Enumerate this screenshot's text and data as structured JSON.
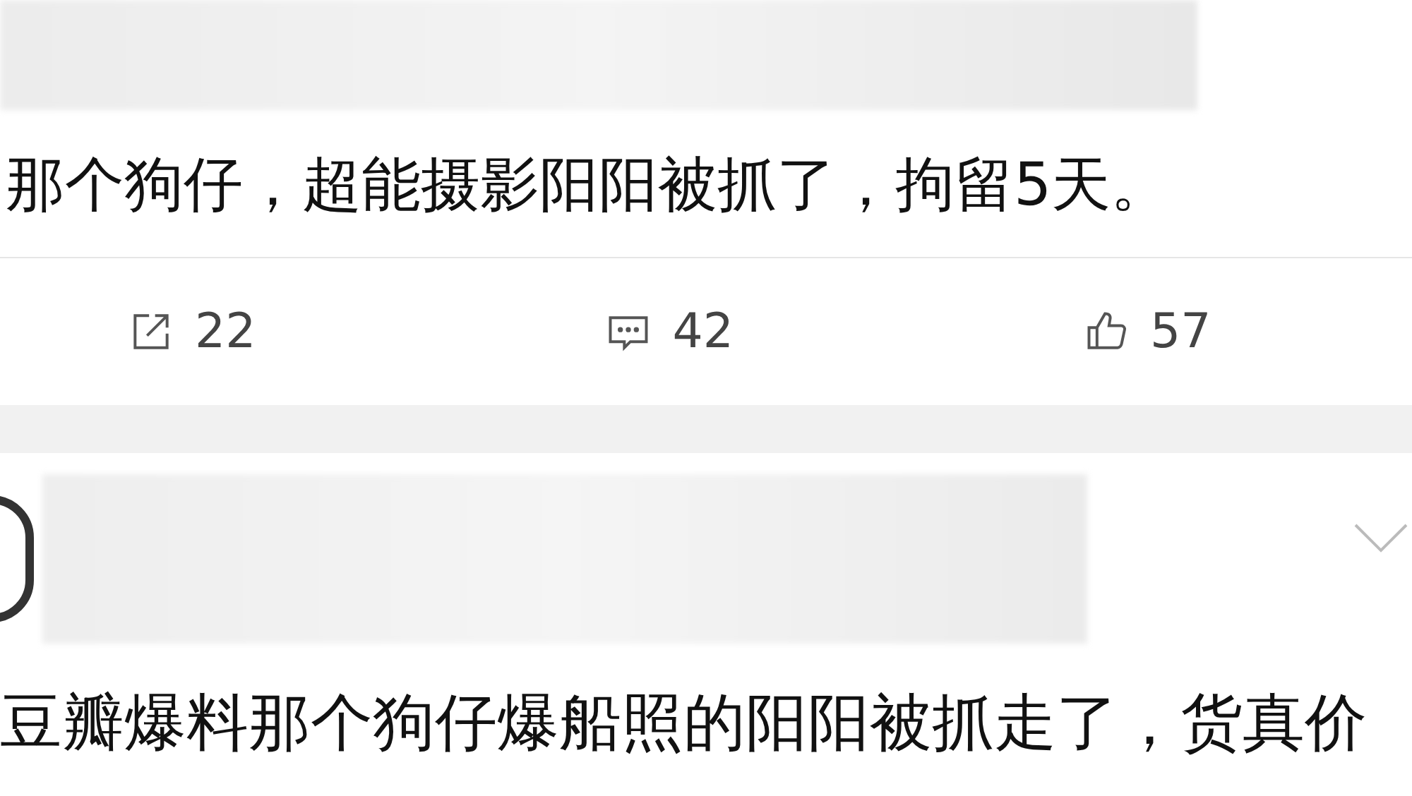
{
  "posts": [
    {
      "text": "那个狗仔，超能摄影阳阳被抓了，拘留5天。",
      "actions": [
        {
          "kind": "repost",
          "count": "22"
        },
        {
          "kind": "comment",
          "count": "42"
        },
        {
          "kind": "like",
          "count": "57"
        }
      ]
    },
    {
      "text": "豆瓣爆料那个狗仔爆船照的阳阳被抓走了，货真价"
    }
  ]
}
